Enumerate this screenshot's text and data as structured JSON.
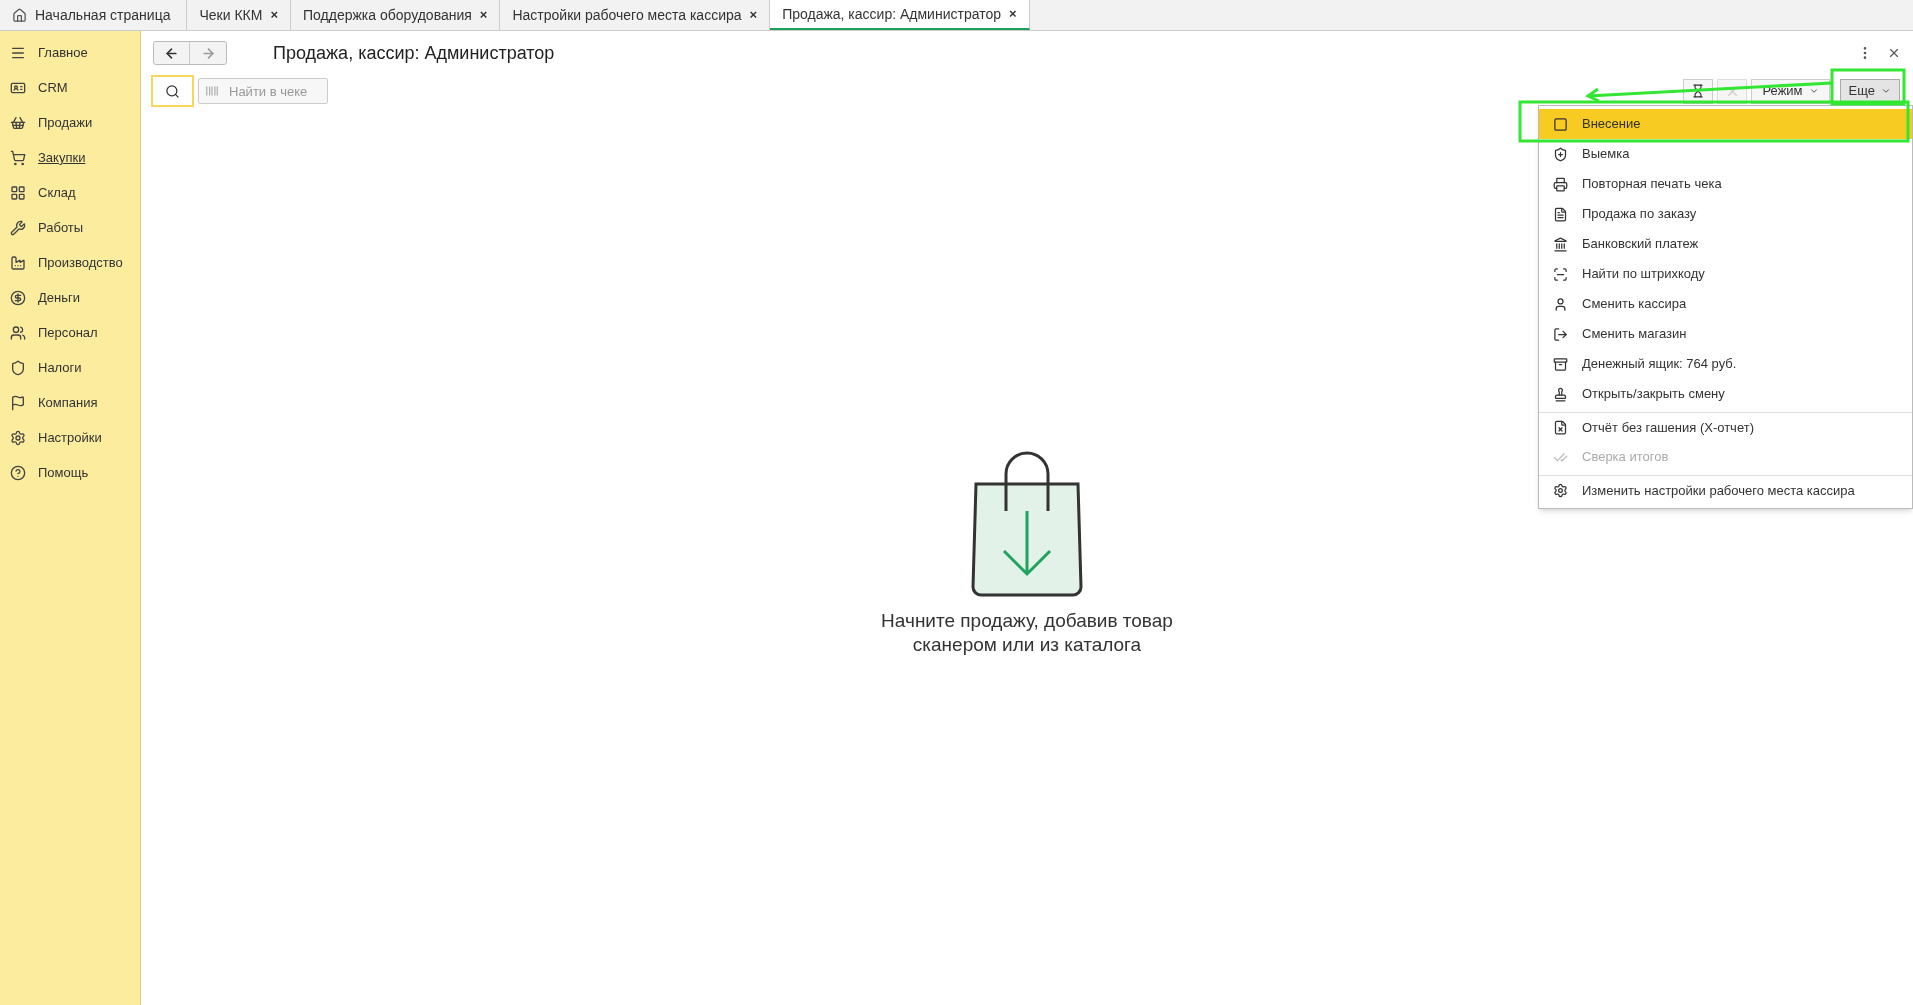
{
  "tabs": [
    {
      "label": "Начальная страница",
      "selected": false,
      "home": true,
      "closable": false
    },
    {
      "label": "Чеки ККМ",
      "selected": false,
      "home": false,
      "closable": true
    },
    {
      "label": "Поддержка оборудования",
      "selected": false,
      "home": false,
      "closable": true
    },
    {
      "label": "Настройки рабочего места кассира",
      "selected": false,
      "home": false,
      "closable": true
    },
    {
      "label": "Продажа, кассир: Администратор",
      "selected": true,
      "home": false,
      "closable": true
    }
  ],
  "tab_close": "×",
  "sidebar": {
    "items": [
      {
        "label": "Главное",
        "underlined": false
      },
      {
        "label": "CRM",
        "underlined": false
      },
      {
        "label": "Продажи",
        "underlined": false
      },
      {
        "label": "Закупки",
        "underlined": true
      },
      {
        "label": "Склад",
        "underlined": false
      },
      {
        "label": "Работы",
        "underlined": false
      },
      {
        "label": "Производство",
        "underlined": false
      },
      {
        "label": "Деньги",
        "underlined": false
      },
      {
        "label": "Персонал",
        "underlined": false
      },
      {
        "label": "Налоги",
        "underlined": false
      },
      {
        "label": "Компания",
        "underlined": false
      },
      {
        "label": "Настройки",
        "underlined": false
      },
      {
        "label": "Помощь",
        "underlined": false
      }
    ]
  },
  "form": {
    "title": "Продажа, кассир: Администратор",
    "search": {
      "placeholder": "Найти в чеке"
    },
    "toolbar": {
      "mode_button": "Режим",
      "more_button": "Еще"
    },
    "empty_state": {
      "text": "Начните продажу, добавив товар сканером или из каталога"
    }
  },
  "menu": {
    "items": [
      {
        "label": "Внесение",
        "selected": true,
        "disabled": false,
        "separator_before": false
      },
      {
        "label": "Выемка",
        "selected": false,
        "disabled": false,
        "separator_before": false
      },
      {
        "label": "Повторная печать чека",
        "selected": false,
        "disabled": false,
        "separator_before": false
      },
      {
        "label": "Продажа по заказу",
        "selected": false,
        "disabled": false,
        "separator_before": false
      },
      {
        "label": "Банковский платеж",
        "selected": false,
        "disabled": false,
        "separator_before": false
      },
      {
        "label": "Найти по штрихкоду",
        "selected": false,
        "disabled": false,
        "separator_before": false
      },
      {
        "label": "Сменить кассира",
        "selected": false,
        "disabled": false,
        "separator_before": false
      },
      {
        "label": "Сменить магазин",
        "selected": false,
        "disabled": false,
        "separator_before": false
      },
      {
        "label": "Денежный ящик: 764 руб.",
        "selected": false,
        "disabled": false,
        "separator_before": false
      },
      {
        "label": "Открыть/закрыть смену",
        "selected": false,
        "disabled": false,
        "separator_before": false
      },
      {
        "label": "Отчёт без гашения (X-отчет)",
        "selected": false,
        "disabled": false,
        "separator_before": true
      },
      {
        "label": "Сверка итогов",
        "selected": false,
        "disabled": true,
        "separator_before": false
      },
      {
        "label": "Изменить настройки рабочего места кассира",
        "selected": false,
        "disabled": false,
        "separator_before": true
      }
    ]
  }
}
